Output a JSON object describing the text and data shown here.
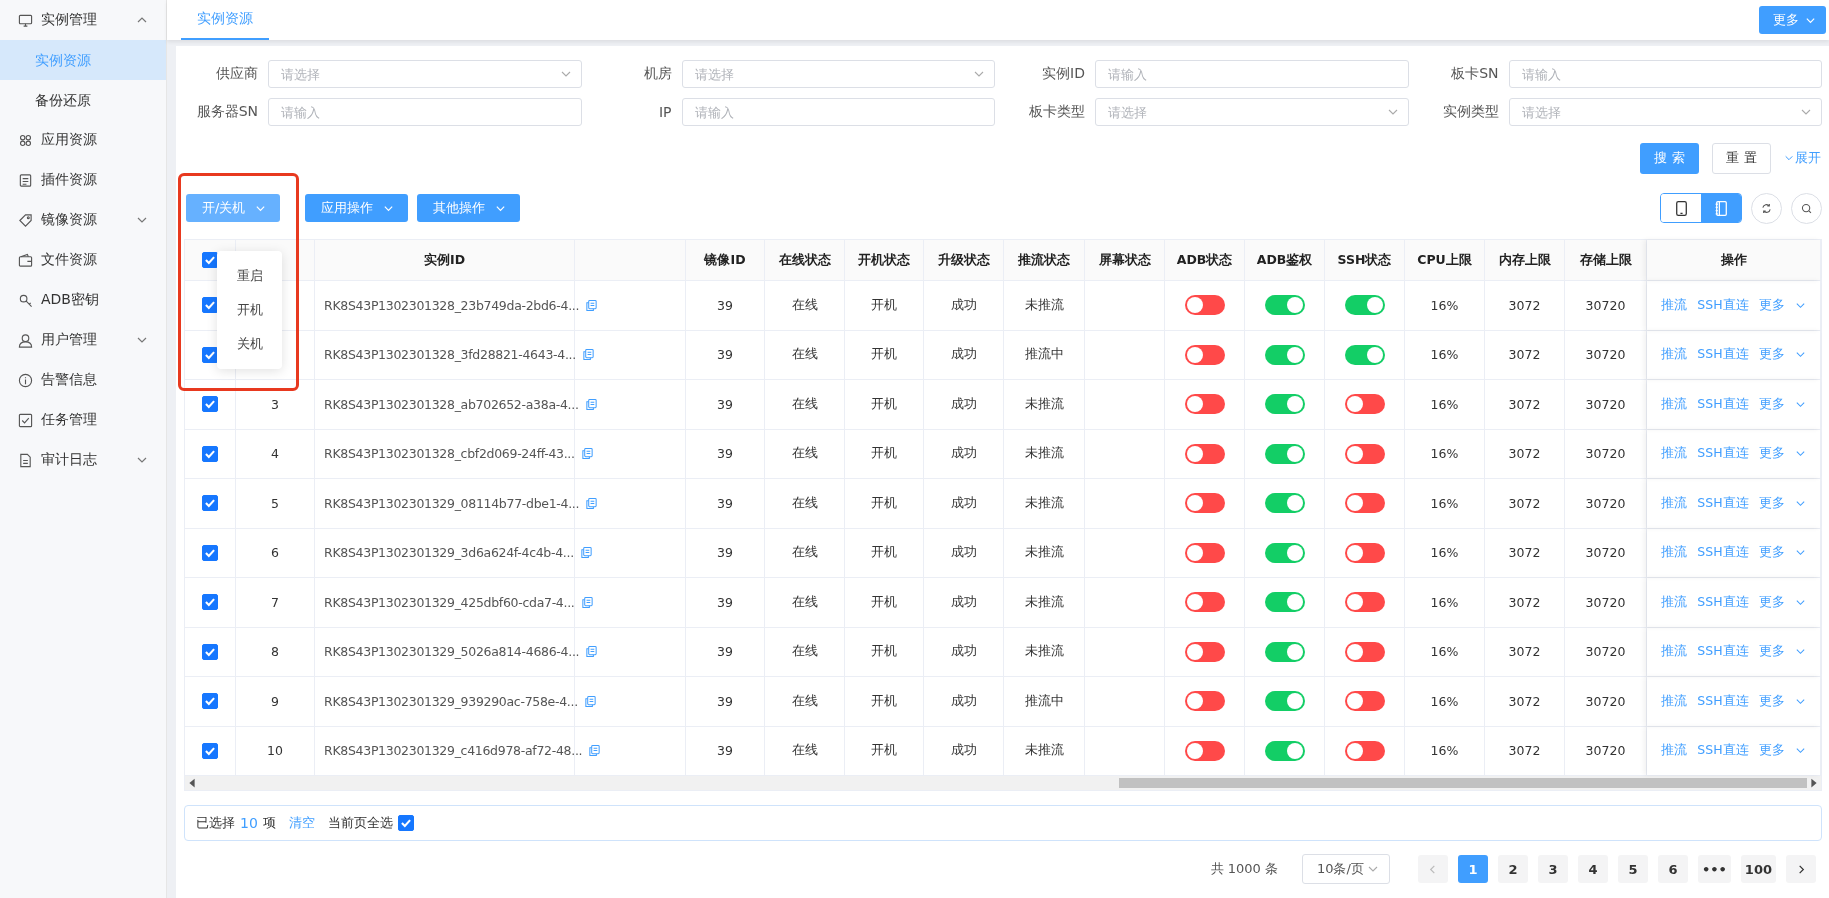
{
  "sidebar": {
    "items": [
      {
        "label": "实例管理",
        "expanded": true,
        "children": [
          {
            "label": "实例资源",
            "selected": true
          },
          {
            "label": "备份还原",
            "selected": false
          }
        ]
      },
      {
        "label": "应用资源"
      },
      {
        "label": "插件资源"
      },
      {
        "label": "镜像资源",
        "expanded": false
      },
      {
        "label": "文件资源"
      },
      {
        "label": "ADB密钥"
      },
      {
        "label": "用户管理",
        "expanded": false
      },
      {
        "label": "告警信息"
      },
      {
        "label": "任务管理"
      },
      {
        "label": "审计日志",
        "expanded": false
      }
    ]
  },
  "tabs": [
    {
      "label": "实例资源",
      "selected": true
    }
  ],
  "more_button": "更多",
  "filters": [
    {
      "label": "供应商",
      "kind": "select",
      "placeholder": "请选择"
    },
    {
      "label": "机房",
      "kind": "select",
      "placeholder": "请选择"
    },
    {
      "label": "实例ID",
      "kind": "input",
      "placeholder": "请输入"
    },
    {
      "label": "板卡SN",
      "kind": "input",
      "placeholder": "请输入"
    },
    {
      "label": "服务器SN",
      "kind": "input",
      "placeholder": "请输入"
    },
    {
      "label": "IP",
      "kind": "input",
      "placeholder": "请输入"
    },
    {
      "label": "板卡类型",
      "kind": "select",
      "placeholder": "请选择"
    },
    {
      "label": "实例类型",
      "kind": "select",
      "placeholder": "请选择"
    }
  ],
  "search_button": "搜 索",
  "reset_button": "重 置",
  "expand_link": "展开",
  "action_buttons": [
    {
      "label": "开/关机",
      "active": true
    },
    {
      "label": "应用操作",
      "active": false
    },
    {
      "label": "其他操作",
      "active": false
    }
  ],
  "view_modes": [
    {
      "kind": "phone",
      "selected": false
    },
    {
      "kind": "list",
      "selected": true
    }
  ],
  "dropdown": {
    "items": [
      "重启",
      "开机",
      "关机"
    ]
  },
  "table": {
    "all_checked": true,
    "columns": [
      "实例ID",
      "镜像ID",
      "在线状态",
      "开机状态",
      "升级状态",
      "推流状态",
      "屏幕状态",
      "ADB状态",
      "ADB鉴权",
      "SSH状态",
      "CPU上限",
      "内存上限",
      "存储上限",
      "操作"
    ],
    "rows": [
      {
        "checked": true,
        "instance_id": "RK8S43P1302301328_23b749da-2bd6-4...",
        "image_id": "39",
        "online": "在线",
        "power": "开机",
        "upgrade": "成功",
        "stream": "未推流",
        "adb": false,
        "adb_auth": true,
        "ssh": true,
        "cpu": "16%",
        "memory": "3072",
        "storage": "30720",
        "actions": [
          "推流",
          "SSH直连",
          "更多"
        ]
      },
      {
        "checked": true,
        "instance_id": "RK8S43P1302301328_3fd28821-4643-4...",
        "image_id": "39",
        "online": "在线",
        "power": "开机",
        "upgrade": "成功",
        "stream": "推流中",
        "adb": false,
        "adb_auth": true,
        "ssh": true,
        "cpu": "16%",
        "memory": "3072",
        "storage": "30720",
        "actions": [
          "推流",
          "SSH直连",
          "更多"
        ]
      },
      {
        "checked": true,
        "index": "3",
        "instance_id": "RK8S43P1302301328_ab702652-a38a-4...",
        "image_id": "39",
        "online": "在线",
        "power": "开机",
        "upgrade": "成功",
        "stream": "未推流",
        "adb": false,
        "adb_auth": true,
        "ssh": false,
        "cpu": "16%",
        "memory": "3072",
        "storage": "30720",
        "actions": [
          "推流",
          "SSH直连",
          "更多"
        ]
      },
      {
        "checked": true,
        "index": "4",
        "instance_id": "RK8S43P1302301328_cbf2d069-24ff-43...",
        "image_id": "39",
        "online": "在线",
        "power": "开机",
        "upgrade": "成功",
        "stream": "未推流",
        "adb": false,
        "adb_auth": true,
        "ssh": false,
        "cpu": "16%",
        "memory": "3072",
        "storage": "30720",
        "actions": [
          "推流",
          "SSH直连",
          "更多"
        ]
      },
      {
        "checked": true,
        "index": "5",
        "instance_id": "RK8S43P1302301329_08114b77-dbe1-4...",
        "image_id": "39",
        "online": "在线",
        "power": "开机",
        "upgrade": "成功",
        "stream": "未推流",
        "adb": false,
        "adb_auth": true,
        "ssh": false,
        "cpu": "16%",
        "memory": "3072",
        "storage": "30720",
        "actions": [
          "推流",
          "SSH直连",
          "更多"
        ]
      },
      {
        "checked": true,
        "index": "6",
        "instance_id": "RK8S43P1302301329_3d6a624f-4c4b-4...",
        "image_id": "39",
        "online": "在线",
        "power": "开机",
        "upgrade": "成功",
        "stream": "未推流",
        "adb": false,
        "adb_auth": true,
        "ssh": false,
        "cpu": "16%",
        "memory": "3072",
        "storage": "30720",
        "actions": [
          "推流",
          "SSH直连",
          "更多"
        ]
      },
      {
        "checked": true,
        "index": "7",
        "instance_id": "RK8S43P1302301329_425dbf60-cda7-4...",
        "image_id": "39",
        "online": "在线",
        "power": "开机",
        "upgrade": "成功",
        "stream": "未推流",
        "adb": false,
        "adb_auth": true,
        "ssh": false,
        "cpu": "16%",
        "memory": "3072",
        "storage": "30720",
        "actions": [
          "推流",
          "SSH直连",
          "更多"
        ]
      },
      {
        "checked": true,
        "index": "8",
        "instance_id": "RK8S43P1302301329_5026a814-4686-4...",
        "image_id": "39",
        "online": "在线",
        "power": "开机",
        "upgrade": "成功",
        "stream": "未推流",
        "adb": false,
        "adb_auth": true,
        "ssh": false,
        "cpu": "16%",
        "memory": "3072",
        "storage": "30720",
        "actions": [
          "推流",
          "SSH直连",
          "更多"
        ]
      },
      {
        "checked": true,
        "index": "9",
        "instance_id": "RK8S43P1302301329_939290ac-758e-4...",
        "image_id": "39",
        "online": "在线",
        "power": "开机",
        "upgrade": "成功",
        "stream": "推流中",
        "adb": false,
        "adb_auth": true,
        "ssh": false,
        "cpu": "16%",
        "memory": "3072",
        "storage": "30720",
        "actions": [
          "推流",
          "SSH直连",
          "更多"
        ]
      },
      {
        "checked": true,
        "index": "10",
        "instance_id": "RK8S43P1302301329_c416d978-af72-48...",
        "image_id": "39",
        "online": "在线",
        "power": "开机",
        "upgrade": "成功",
        "stream": "未推流",
        "adb": false,
        "adb_auth": true,
        "ssh": false,
        "cpu": "16%",
        "memory": "3072",
        "storage": "30720",
        "actions": [
          "推流",
          "SSH直连",
          "更多"
        ]
      }
    ]
  },
  "selection_bar": {
    "prefix": "已选择",
    "count": "10",
    "suffix": "项",
    "clear_link": "清空",
    "select_page_label": "当前页全选",
    "select_page_checked": true
  },
  "pagination": {
    "total": "共 1000 条",
    "page_size": "10条/页",
    "pages": [
      {
        "label": "1",
        "selected": true
      },
      {
        "label": "2",
        "selected": false
      },
      {
        "label": "3",
        "selected": false
      },
      {
        "label": "4",
        "selected": false
      },
      {
        "label": "5",
        "selected": false
      },
      {
        "label": "6",
        "selected": false
      },
      {
        "label": "•••",
        "selected": false
      },
      {
        "label": "100",
        "selected": false
      }
    ]
  }
}
